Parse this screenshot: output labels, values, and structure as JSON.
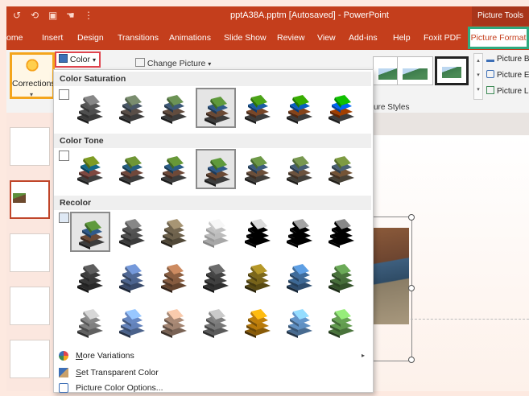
{
  "title_bar": {
    "document_title": "pptA38A.pptm [Autosaved]  -  PowerPoint",
    "contextual_label": "Picture Tools",
    "quick_access": [
      "undo-icon",
      "redo-icon",
      "present-icon",
      "touch-mode-icon",
      "customize-icon"
    ]
  },
  "tabs": [
    {
      "label": "ome"
    },
    {
      "label": "Insert"
    },
    {
      "label": "Design"
    },
    {
      "label": "Transitions"
    },
    {
      "label": "Animations"
    },
    {
      "label": "Slide Show"
    },
    {
      "label": "Review"
    },
    {
      "label": "View"
    },
    {
      "label": "Add-ins"
    },
    {
      "label": "Help"
    },
    {
      "label": "Foxit PDF"
    },
    {
      "label": "Picture Format",
      "active": true
    }
  ],
  "ribbon": {
    "corrections_label": "Corrections",
    "color_label": "Color",
    "change_picture_label": "Change Picture",
    "styles_label": "ure Styles",
    "right_items": [
      "Picture Bor",
      "Picture Effe",
      "Picture Lay"
    ]
  },
  "color_menu": {
    "sections": {
      "saturation": "Color Saturation",
      "tone": "Color Tone",
      "recolor": "Recolor"
    },
    "items": {
      "more_variations_key": "M",
      "more_variations_rest": "ore Variations",
      "set_transparent_key": "S",
      "set_transparent_rest": "et Transparent Color",
      "picture_color_options": "Picture Color Options..."
    }
  },
  "colors": {
    "accent": "#c43e1c",
    "contextual_highlight": "#2faa7f",
    "corrections_highlight": "#f4a51c",
    "color_button_highlight": "#e0454f"
  }
}
